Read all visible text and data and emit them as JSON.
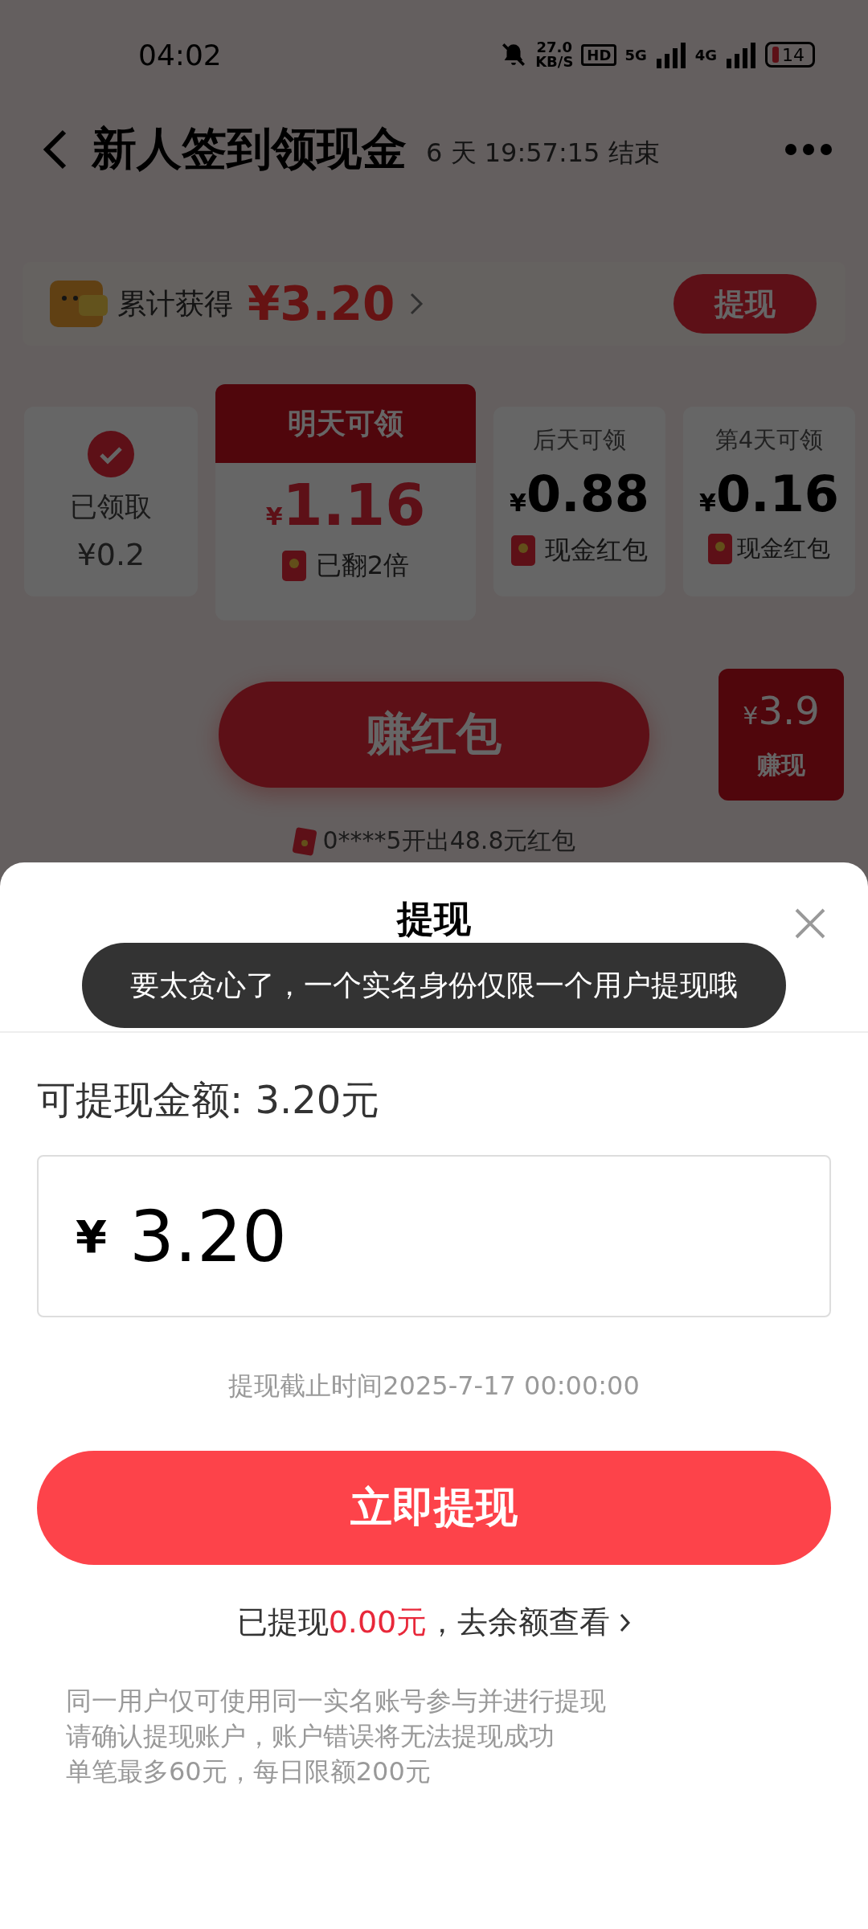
{
  "status_bar": {
    "time": "04:02",
    "speed": "27.0",
    "speed_unit": "KB/S",
    "hd": "HD",
    "net_1": "5G",
    "net_2": "4G",
    "battery": "14"
  },
  "header": {
    "title": "新人签到领现金",
    "countdown": "6 天 19:57:15 结束"
  },
  "total": {
    "label": "累计获得",
    "amount": "¥3.20",
    "button": "提现"
  },
  "days": [
    {
      "kind": "claimed",
      "label": "已领取",
      "amount": "¥0.2"
    },
    {
      "kind": "next",
      "label": "明天可领",
      "currency": "¥",
      "amount": "1.16",
      "note": "已翻2倍"
    },
    {
      "kind": "upcoming",
      "label": "后天可领",
      "currency": "¥",
      "amount": "0.88",
      "note": "现金红包"
    },
    {
      "kind": "upcoming",
      "label": "第4天可领",
      "currency": "¥",
      "amount": "0.16",
      "note": "现金红包"
    }
  ],
  "earn_button": "赚红包",
  "promo": {
    "currency": "¥",
    "amount": "3.9",
    "label": "赚现"
  },
  "ticker": "0****5开出48.8元红包",
  "sheet": {
    "title": "提现",
    "toast": "要太贪心了，一个实名身份仅限一个用户提现哦",
    "available": "可提现金额: 3.20元",
    "currency": "¥",
    "value": "3.20",
    "deadline": "提现截止时间2025-7-17 00:00:00",
    "submit": "立即提现",
    "withdrawn_prefix": "已提现",
    "withdrawn_amount": "0.00元",
    "withdrawn_suffix": "，去余额查看",
    "notes": [
      "同一用户仅可使用同一实名账号参与并进行提现",
      "请确认提现账户，账户错误将无法提现成功",
      "单笔最多60元，每日限额200元"
    ]
  }
}
